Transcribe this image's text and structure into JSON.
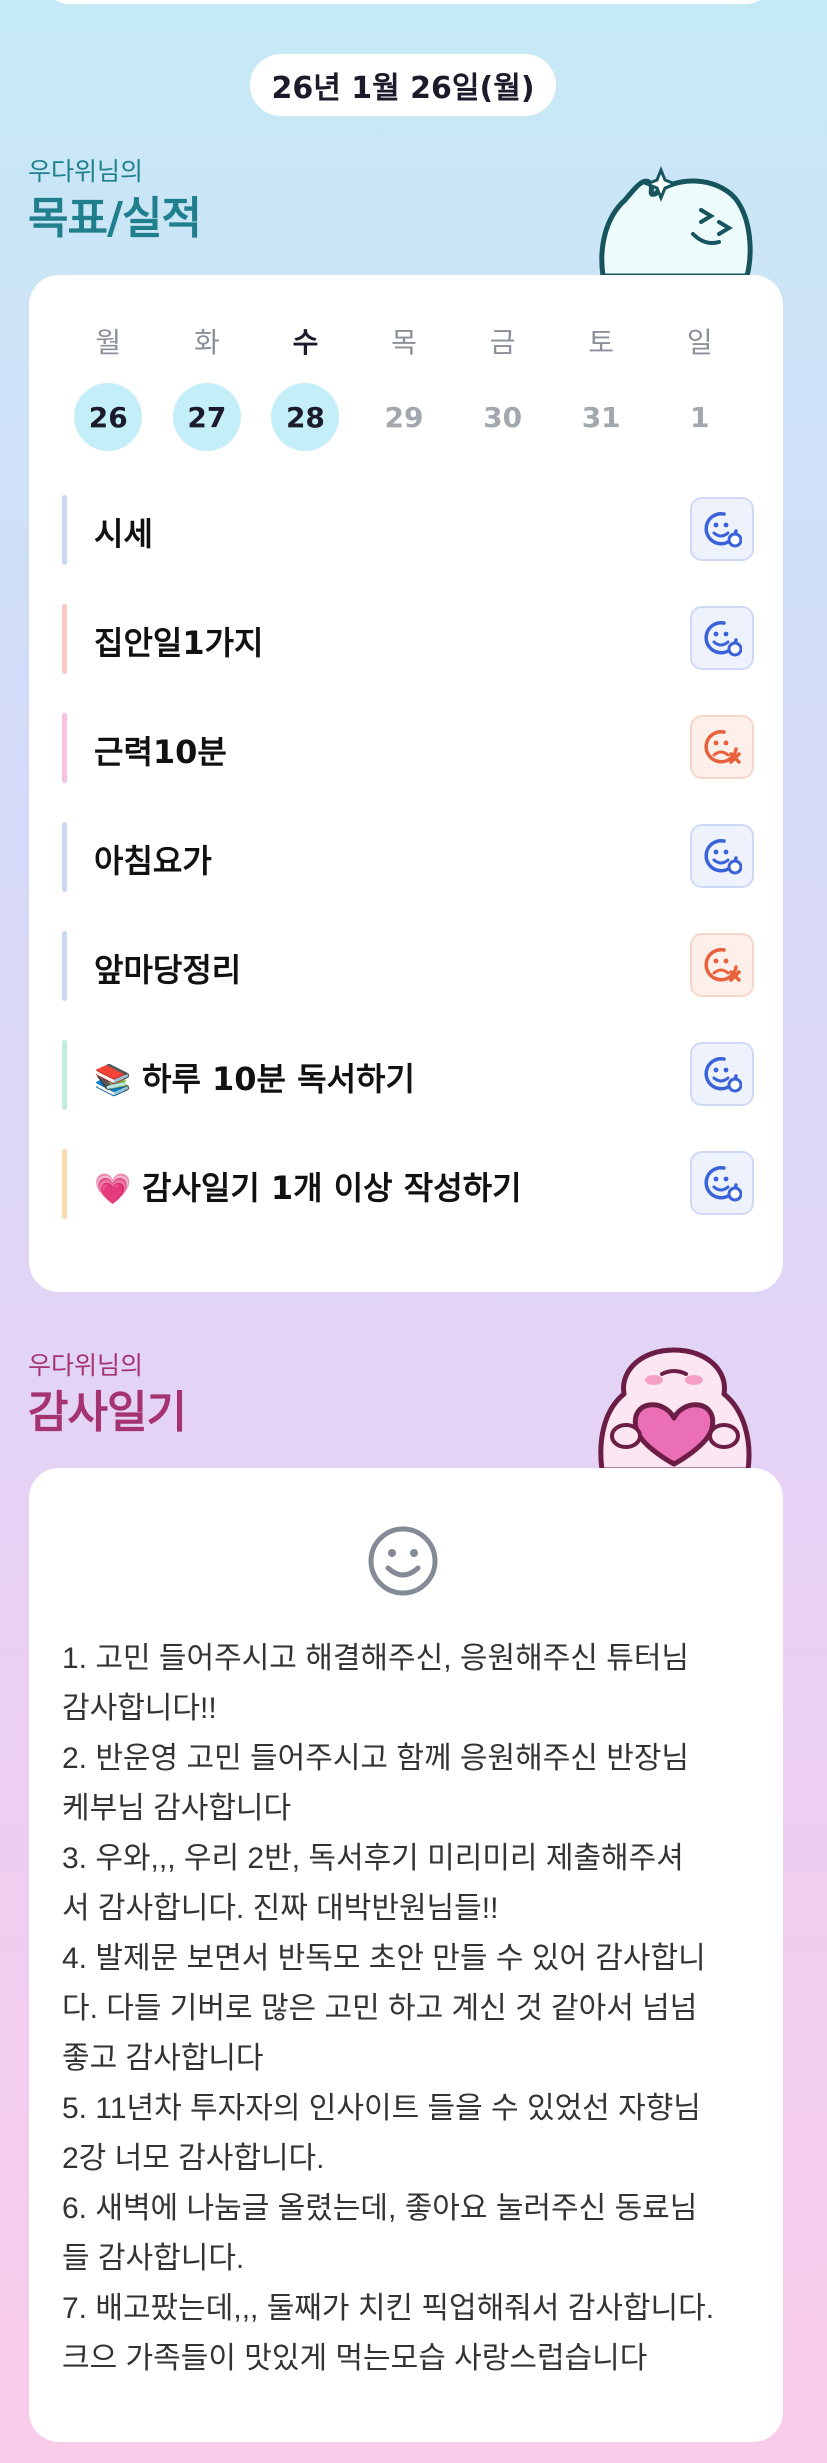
{
  "date_label": "26년 1월 26일(월)",
  "goals_section": {
    "owner": "우다위님의",
    "title": "목표/실적"
  },
  "week": [
    {
      "day": "월",
      "date": "26",
      "done": true,
      "today": false
    },
    {
      "day": "화",
      "date": "27",
      "done": true,
      "today": false
    },
    {
      "day": "수",
      "date": "28",
      "done": true,
      "today": true
    },
    {
      "day": "목",
      "date": "29",
      "done": false,
      "today": false
    },
    {
      "day": "금",
      "date": "30",
      "done": false,
      "today": false
    },
    {
      "day": "토",
      "date": "31",
      "done": false,
      "today": false
    },
    {
      "day": "일",
      "date": "1",
      "done": false,
      "today": false
    }
  ],
  "goals": [
    {
      "label": "시세",
      "emoji": "",
      "bar_color": "#c9d8f4",
      "status": "success"
    },
    {
      "label": "집안일1가지",
      "emoji": "",
      "bar_color": "#f8c9c2",
      "status": "success"
    },
    {
      "label": "근력10분",
      "emoji": "",
      "bar_color": "#f7c2e0",
      "status": "fail"
    },
    {
      "label": "아침요가",
      "emoji": "",
      "bar_color": "#c9d8f4",
      "status": "success"
    },
    {
      "label": "앞마당정리",
      "emoji": "",
      "bar_color": "#c9d8f4",
      "status": "fail"
    },
    {
      "label": "하루 10분 독서하기",
      "emoji": "📚",
      "bar_color": "#bfeedd",
      "status": "success"
    },
    {
      "label": "감사일기 1개 이상 작성하기",
      "emoji": "💗",
      "bar_color": "#f8dcae",
      "status": "success"
    }
  ],
  "status_colors": {
    "success": "#3a63d9",
    "fail": "#e8603c"
  },
  "gratitude_section": {
    "owner": "우다위님의",
    "title": "감사일기"
  },
  "journal_lines": [
    "1. 고민 들어주시고 해결해주신, 응원해주신 튜터님",
    "감사합니다!!",
    "2. 반운영 고민 들어주시고 함께 응원해주신 반장님",
    "케부님 감사합니다",
    "3. 우와,,, 우리 2반, 독서후기 미리미리 제출해주셔",
    "서 감사합니다. 진짜 대박반원님들!!",
    "4. 발제문 보면서 반독모 초안 만들 수 있어 감사합니",
    "다. 다들 기버로 많은 고민 하고 계신 것 같아서 넘넘",
    "좋고 감사합니다",
    "5. 11년차 투자자의 인사이트 들을 수 있었선 자향님",
    "2강 너모 감사합니다.",
    "6. 새벽에 나눔글 올렸는데, 좋아요 눌러주신 동료님",
    "들 감사합니다.",
    "7. 배고팠는데,,, 둘째가 치킨 픽업해줘서 감사합니다.",
    "크으 가족들이 맛있게 먹는모습 사랑스럽습니다"
  ]
}
